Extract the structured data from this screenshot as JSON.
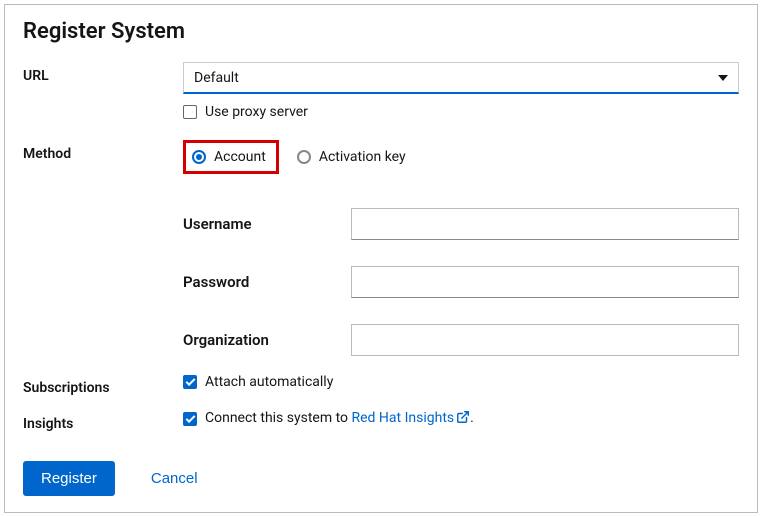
{
  "title": "Register System",
  "url": {
    "label": "URL",
    "selected": "Default",
    "proxy_label": "Use proxy server",
    "proxy_checked": false
  },
  "method": {
    "label": "Method",
    "options": {
      "account": "Account",
      "activation_key": "Activation key"
    },
    "selected": "account",
    "fields": {
      "username_label": "Username",
      "username_value": "",
      "password_label": "Password",
      "password_value": "",
      "organization_label": "Organization",
      "organization_value": ""
    }
  },
  "subscriptions": {
    "label": "Subscriptions",
    "attach_label": "Attach automatically",
    "attach_checked": true
  },
  "insights": {
    "label": "Insights",
    "prefix": "Connect this system to ",
    "link_text": "Red Hat Insights",
    "suffix": ".",
    "checked": true
  },
  "actions": {
    "register": "Register",
    "cancel": "Cancel"
  }
}
